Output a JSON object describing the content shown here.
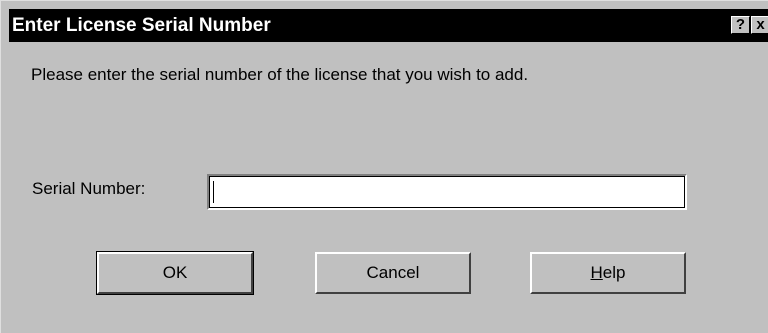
{
  "dialog": {
    "title": "Enter License Serial Number",
    "help_glyph": "?",
    "close_glyph": "x",
    "message": "Please enter the serial number of the license that you wish to add.",
    "serial_label": "Serial Number:",
    "serial_value": "",
    "buttons": {
      "ok": "OK",
      "cancel": "Cancel",
      "help_mnemonic": "H",
      "help_rest": "elp"
    }
  },
  "colors": {
    "face": "#c0c0c0",
    "titlebar": "#000000",
    "title_text": "#ffffff"
  }
}
